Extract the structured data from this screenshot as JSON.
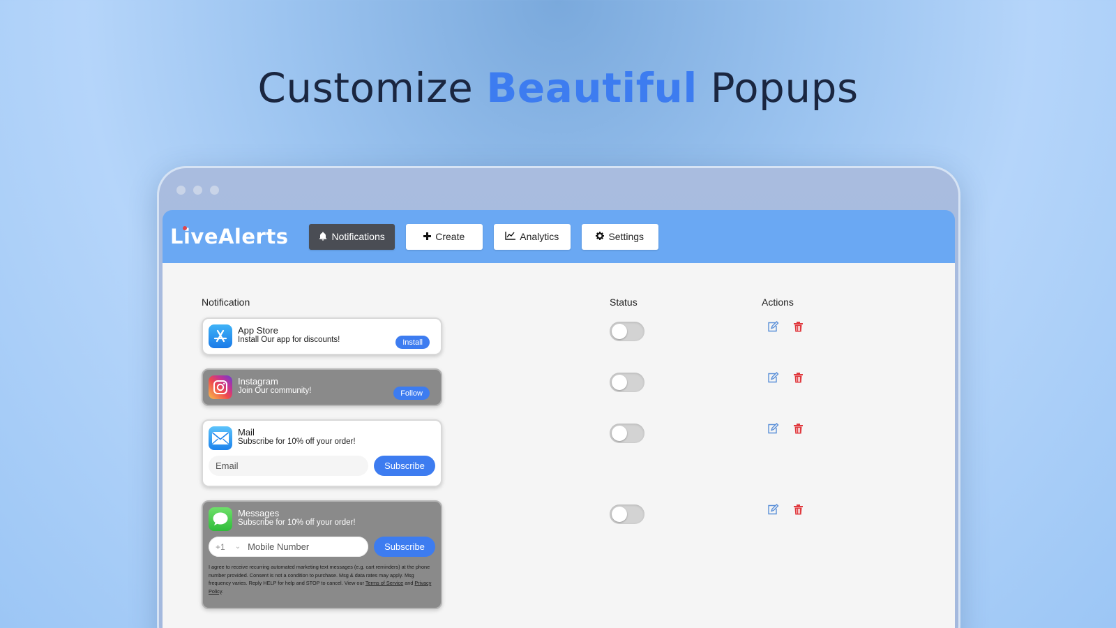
{
  "headline": {
    "part1": "Customize ",
    "accent": "Beautiful",
    "part2": " Popups"
  },
  "app": {
    "logo": "LiveAlerts",
    "nav": [
      {
        "label": "Notifications",
        "icon": "bell-icon",
        "active": true
      },
      {
        "label": "Create",
        "icon": "plus-icon"
      },
      {
        "label": "Analytics",
        "icon": "chart-line-icon"
      },
      {
        "label": "Settings",
        "icon": "gear-icon"
      }
    ]
  },
  "table": {
    "headers": {
      "notification": "Notification",
      "status": "Status",
      "actions": "Actions"
    },
    "rows": [
      {
        "title": "App Store",
        "subtitle": "Install Our app for discounts!",
        "cta": "Install",
        "theme": "light",
        "status": "off"
      },
      {
        "title": "Instagram",
        "subtitle": "Join Our community!",
        "cta": "Follow",
        "theme": "dark",
        "status": "off"
      },
      {
        "title": "Mail",
        "subtitle": "Subscribe for 10% off your order!",
        "input_placeholder": "Email",
        "cta": "Subscribe",
        "theme": "light",
        "status": "off"
      },
      {
        "title": "Messages",
        "subtitle": "Subscribe for 10% off your order!",
        "phone_code": "+1",
        "input_placeholder": "Mobile Number",
        "cta": "Subscribe",
        "theme": "dark",
        "status": "off",
        "consent": {
          "text": "I agree to receive recurring automated marketing text messages (e.g. cart reminders) at the phone number provided. Consent is not a condition to purchase. Msg & data rates may apply. Msg frequency varies. Reply HELP for help and STOP to cancel. View our ",
          "terms": "Terms of Service",
          "and": " and ",
          "privacy": "Privacy Policy",
          "end": "."
        }
      }
    ]
  },
  "colors": {
    "accent": "#3d7cf0",
    "appbar": "#6aa8f3",
    "delete": "#e0393e",
    "edit": "#5a8fd8"
  }
}
